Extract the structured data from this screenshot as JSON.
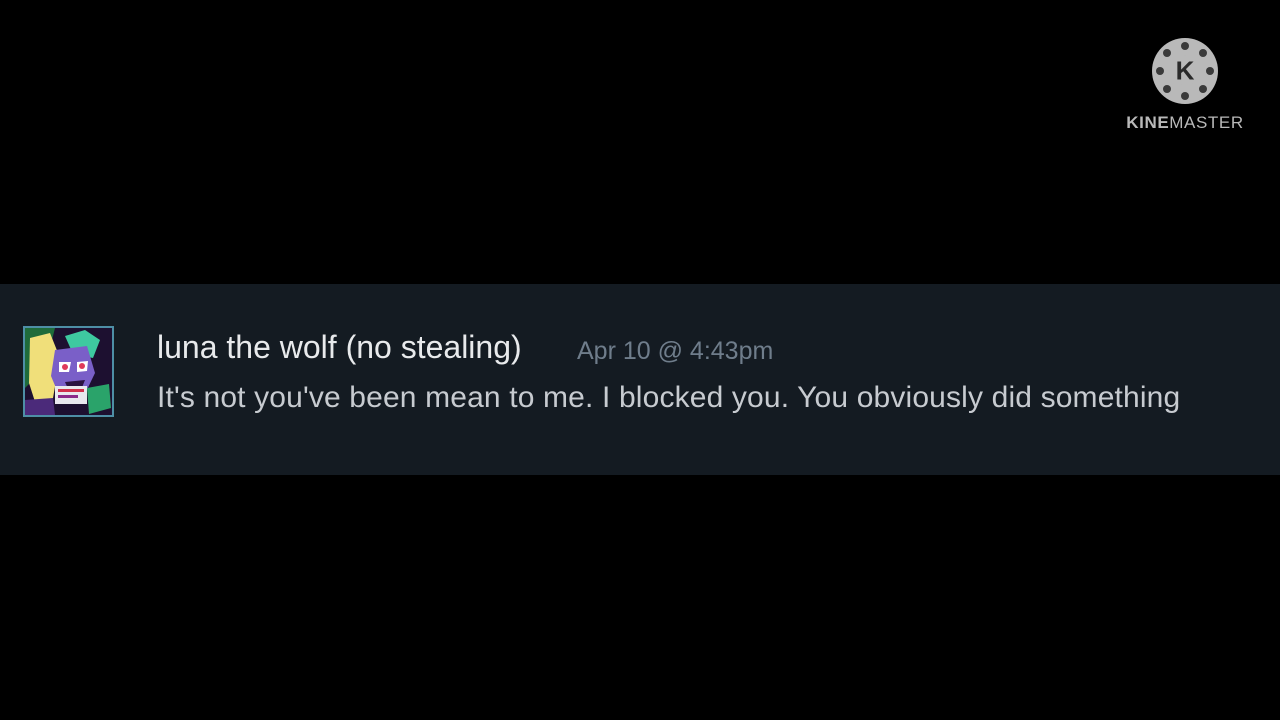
{
  "watermark": {
    "logo_letter": "K",
    "brand_bold": "KINE",
    "brand_light": "MASTER"
  },
  "message": {
    "username": "luna the wolf (no stealing)",
    "timestamp": "Apr 10 @ 4:43pm",
    "text": "It's not you've been mean to me. I blocked you. You obviously did something",
    "avatar_icon": "wolf-avatar-icon"
  },
  "colors": {
    "background": "#000000",
    "strip_background": "#141b22",
    "username": "#e8eaec",
    "timestamp": "#6f7d8b",
    "message_text": "#c7cbd0",
    "avatar_border": "#4e8fa6",
    "watermark": "#b9b9b9"
  }
}
